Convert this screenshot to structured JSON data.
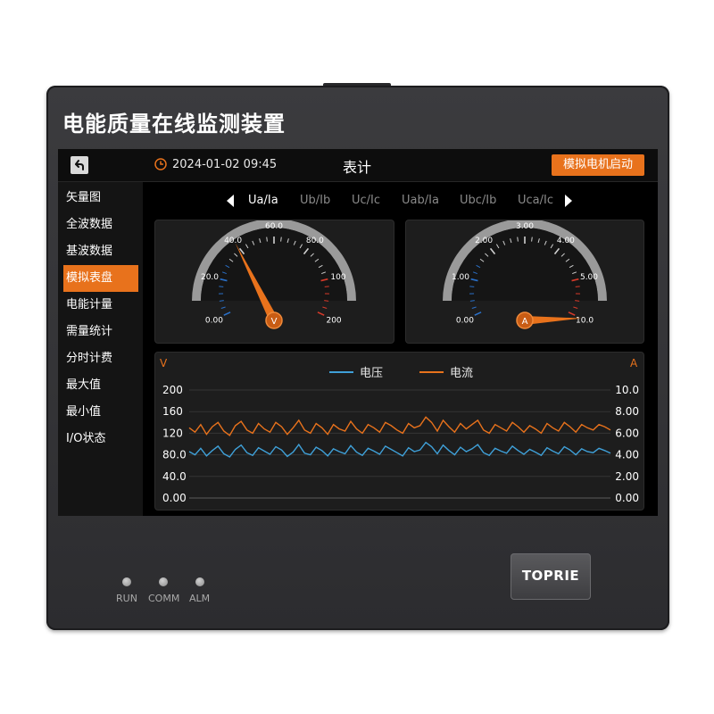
{
  "device": {
    "title": "电能质量在线监测装置",
    "brand": "TOPRIE",
    "indicators": [
      "RUN",
      "COMM",
      "ALM"
    ]
  },
  "topbar": {
    "back_icon": "back-arrow-icon",
    "clock_icon": "clock-icon",
    "datetime": "2024-01-02 09:45",
    "page_title": "表计",
    "action_button": "模拟电机启动"
  },
  "sidebar": {
    "items": [
      "矢量图",
      "全波数据",
      "基波数据",
      "模拟表盘",
      "电能计量",
      "需量统计",
      "分时计费",
      "最大值",
      "最小值",
      "I/O状态"
    ],
    "active_index": 3
  },
  "channels": {
    "items": [
      "Ua/Ia",
      "Ub/Ib",
      "Uc/Ic",
      "Uab/Ia",
      "Ubc/Ib",
      "Uca/Ic"
    ],
    "active_index": 0
  },
  "gauges": [
    {
      "unit": "V",
      "ticks": [
        "0.00",
        "20.0",
        "40.0",
        "60.0",
        "80.0",
        "100",
        "200"
      ],
      "value": 40
    },
    {
      "unit": "A",
      "ticks": [
        "0.00",
        "1.00",
        "2.00",
        "3.00",
        "4.00",
        "5.00",
        "10.0"
      ],
      "value": 10
    }
  ],
  "colors": {
    "accent": "#e8721c",
    "voltage": "#3fa0d8",
    "current": "#e8721c",
    "scale_low": "#2a70c8",
    "scale_high": "#d83a2a"
  },
  "chart_data": {
    "type": "line",
    "legend": [
      "电压",
      "电流"
    ],
    "left_unit": "V",
    "right_unit": "A",
    "y_left_ticks": [
      "200",
      "160",
      "120",
      "80.0",
      "40.0",
      "0.00"
    ],
    "y_right_ticks": [
      "10.0",
      "8.00",
      "6.00",
      "4.00",
      "2.00",
      "0.00"
    ],
    "ylim_left": [
      0,
      200
    ],
    "ylim_right": [
      0,
      10
    ],
    "series": [
      {
        "name": "电压",
        "axis": "left",
        "values": [
          86,
          80,
          92,
          78,
          88,
          96,
          82,
          76,
          90,
          98,
          84,
          79,
          93,
          87,
          81,
          95,
          89,
          77,
          85,
          99,
          83,
          80,
          94,
          88,
          78,
          91,
          86,
          82,
          97,
          85,
          79,
          92,
          87,
          81,
          96,
          90,
          84,
          78,
          93,
          86,
          89,
          103,
          95,
          82,
          98,
          88,
          80,
          94,
          86,
          91,
          99,
          84,
          79,
          92,
          87,
          83,
          96,
          88,
          81,
          90,
          85,
          79,
          93,
          87,
          82,
          95,
          89,
          80,
          91,
          86,
          84,
          92,
          88,
          83
        ]
      },
      {
        "name": "电流",
        "axis": "right",
        "values": [
          6.5,
          6.1,
          6.8,
          5.9,
          6.6,
          7.0,
          6.2,
          5.8,
          6.7,
          7.1,
          6.3,
          6.0,
          6.9,
          6.4,
          6.1,
          7.0,
          6.6,
          5.9,
          6.5,
          7.2,
          6.3,
          6.0,
          6.9,
          6.5,
          5.9,
          6.8,
          6.4,
          6.2,
          7.1,
          6.4,
          6.0,
          6.8,
          6.5,
          6.1,
          7.0,
          6.7,
          6.3,
          6.0,
          6.9,
          6.5,
          6.7,
          7.5,
          7.0,
          6.2,
          7.2,
          6.6,
          6.1,
          6.9,
          6.4,
          6.8,
          7.2,
          6.3,
          6.0,
          6.8,
          6.5,
          6.2,
          7.0,
          6.6,
          6.1,
          6.7,
          6.4,
          6.0,
          6.9,
          6.5,
          6.2,
          7.0,
          6.6,
          6.1,
          6.8,
          6.5,
          6.3,
          6.8,
          6.6,
          6.3
        ]
      }
    ]
  }
}
